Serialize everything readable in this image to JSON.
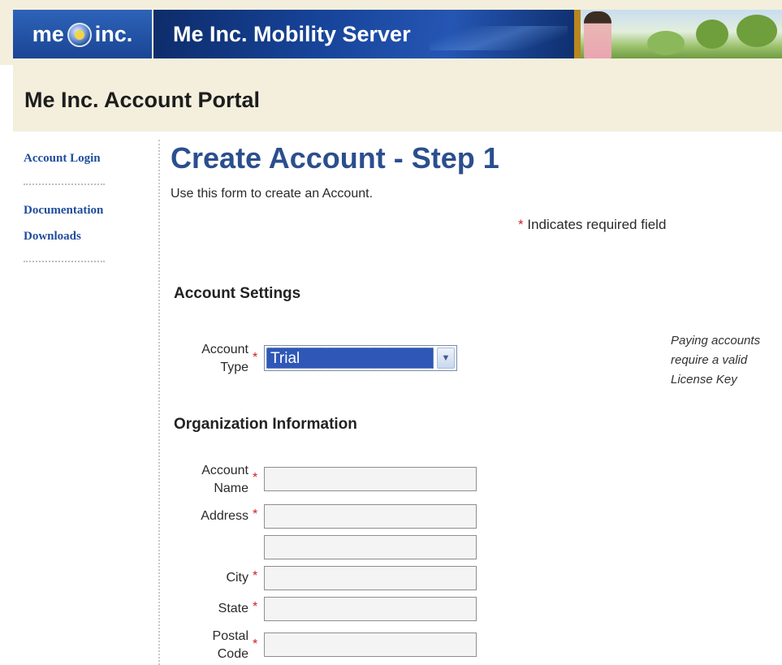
{
  "banner": {
    "logo_left": "me",
    "logo_right": "inc.",
    "server_title": "Me Inc. Mobility Server"
  },
  "portal": {
    "title": "Me Inc. Account Portal"
  },
  "sidebar": {
    "items": [
      {
        "label": "Account Login"
      },
      {
        "label": "Documentation"
      },
      {
        "label": "Downloads"
      }
    ]
  },
  "main": {
    "heading": "Create Account - Step 1",
    "intro": "Use this form to create an Account.",
    "required_star": "*",
    "required_note": "Indicates required field",
    "sections": {
      "account_settings": "Account Settings",
      "organization": "Organization Information"
    },
    "account_type": {
      "label_line1": "Account",
      "label_line2": "Type",
      "value": "Trial",
      "note": "Paying accounts require a valid License Key"
    },
    "fields": {
      "account_name": {
        "label_line1": "Account",
        "label_line2": "Name",
        "value": ""
      },
      "address": {
        "label": "Address",
        "value": "",
        "value2": ""
      },
      "city": {
        "label": "City",
        "value": ""
      },
      "state": {
        "label": "State",
        "value": ""
      },
      "postal_code": {
        "label_line1": "Postal",
        "label_line2": "Code",
        "value": ""
      }
    }
  },
  "colors": {
    "banner_bg": "#f3efdc",
    "logo_blue": "#1b4595",
    "link_blue": "#1f4c9c",
    "heading_blue": "#2b4e8e",
    "required_red": "#cc2222",
    "select_highlight": "#2e57b8"
  }
}
